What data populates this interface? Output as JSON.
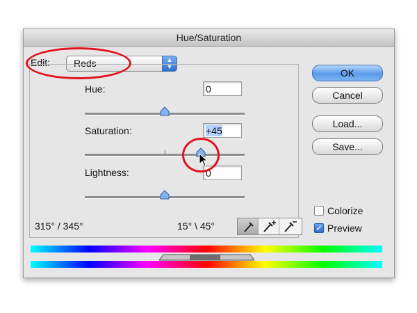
{
  "window": {
    "title": "Hue/Saturation"
  },
  "edit": {
    "label": "Edit:",
    "selected": "Reds"
  },
  "hue": {
    "label": "Hue:",
    "value": "0",
    "slider_fraction": 0.5
  },
  "saturation": {
    "label": "Saturation:",
    "value": "+45",
    "slider_fraction": 0.725
  },
  "lightness": {
    "label": "Lightness:",
    "value": "0",
    "slider_fraction": 0.5
  },
  "buttons": {
    "ok": "OK",
    "cancel": "Cancel",
    "load": "Load...",
    "save": "Save..."
  },
  "options": {
    "colorize": {
      "label": "Colorize",
      "checked": false
    },
    "preview": {
      "label": "Preview",
      "checked": true
    }
  },
  "ranges": {
    "left": "315° / 345°",
    "right": "15° \\ 45°"
  },
  "icons": [
    "eyedropper-icon",
    "eyedropper-plus-icon",
    "eyedropper-minus-icon"
  ],
  "colors": {
    "annotation_red": "#e0141e",
    "ok_blue": "#5a9ae8"
  }
}
